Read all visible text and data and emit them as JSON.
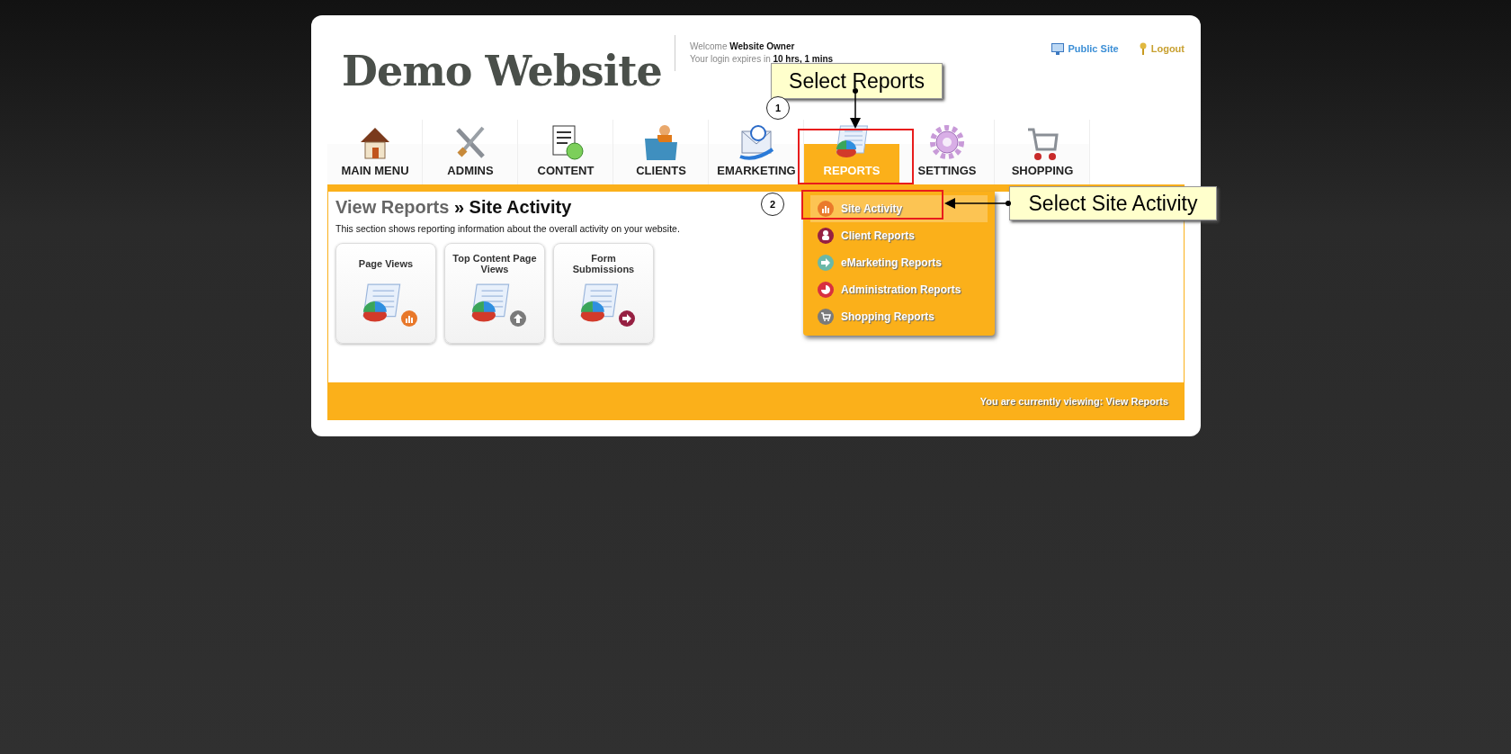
{
  "header": {
    "logo": "Demo Website",
    "welcome": "Welcome **Website Owner**",
    "expiry": "Your login expires in **10 hrs, 1 mins**",
    "links": [
      {
        "label": "Public Site",
        "kind": "monitor"
      },
      {
        "label": "Logout",
        "kind": "key"
      }
    ]
  },
  "tabs": [
    {
      "label": "MAIN MENU",
      "kind": "house",
      "selected": false
    },
    {
      "label": "ADMINS",
      "kind": "tools",
      "selected": false
    },
    {
      "label": "CONTENT",
      "kind": "document",
      "selected": false
    },
    {
      "label": "CLIENTS",
      "kind": "folder",
      "selected": false
    },
    {
      "label": "EMARKETING",
      "kind": "envelope",
      "selected": false
    },
    {
      "label": "REPORTS",
      "kind": "report",
      "selected": true
    },
    {
      "label": "SETTINGS",
      "kind": "gear",
      "selected": false
    },
    {
      "label": "SHOPPING",
      "kind": "cart",
      "selected": false
    }
  ],
  "page": {
    "breadcrumb": "View Reports",
    "title": "» Site Activity",
    "description": "This section shows reporting information about the overall activity on your website.",
    "tiles": [
      {
        "label": "Page Views",
        "kind": "bars"
      },
      {
        "label": "Top Content Page Views",
        "kind": "up"
      },
      {
        "label": "Form Submissions",
        "kind": "arrow"
      }
    ]
  },
  "dropdown": [
    {
      "label": "Site Activity",
      "kind": "bars",
      "selected": true
    },
    {
      "label": "Client Reports",
      "kind": "person",
      "selected": false
    },
    {
      "label": "eMarketing Reports",
      "kind": "arrow",
      "selected": false
    },
    {
      "label": "Administration Reports",
      "kind": "pie",
      "selected": false
    },
    {
      "label": "Shopping Reports",
      "kind": "cart",
      "selected": false
    }
  ],
  "status_bar": "You are currently viewing: View Reports",
  "annotations": [
    {
      "step": "1",
      "text": "Select Reports"
    },
    {
      "step": "2",
      "text": "Select Site Activity"
    }
  ]
}
